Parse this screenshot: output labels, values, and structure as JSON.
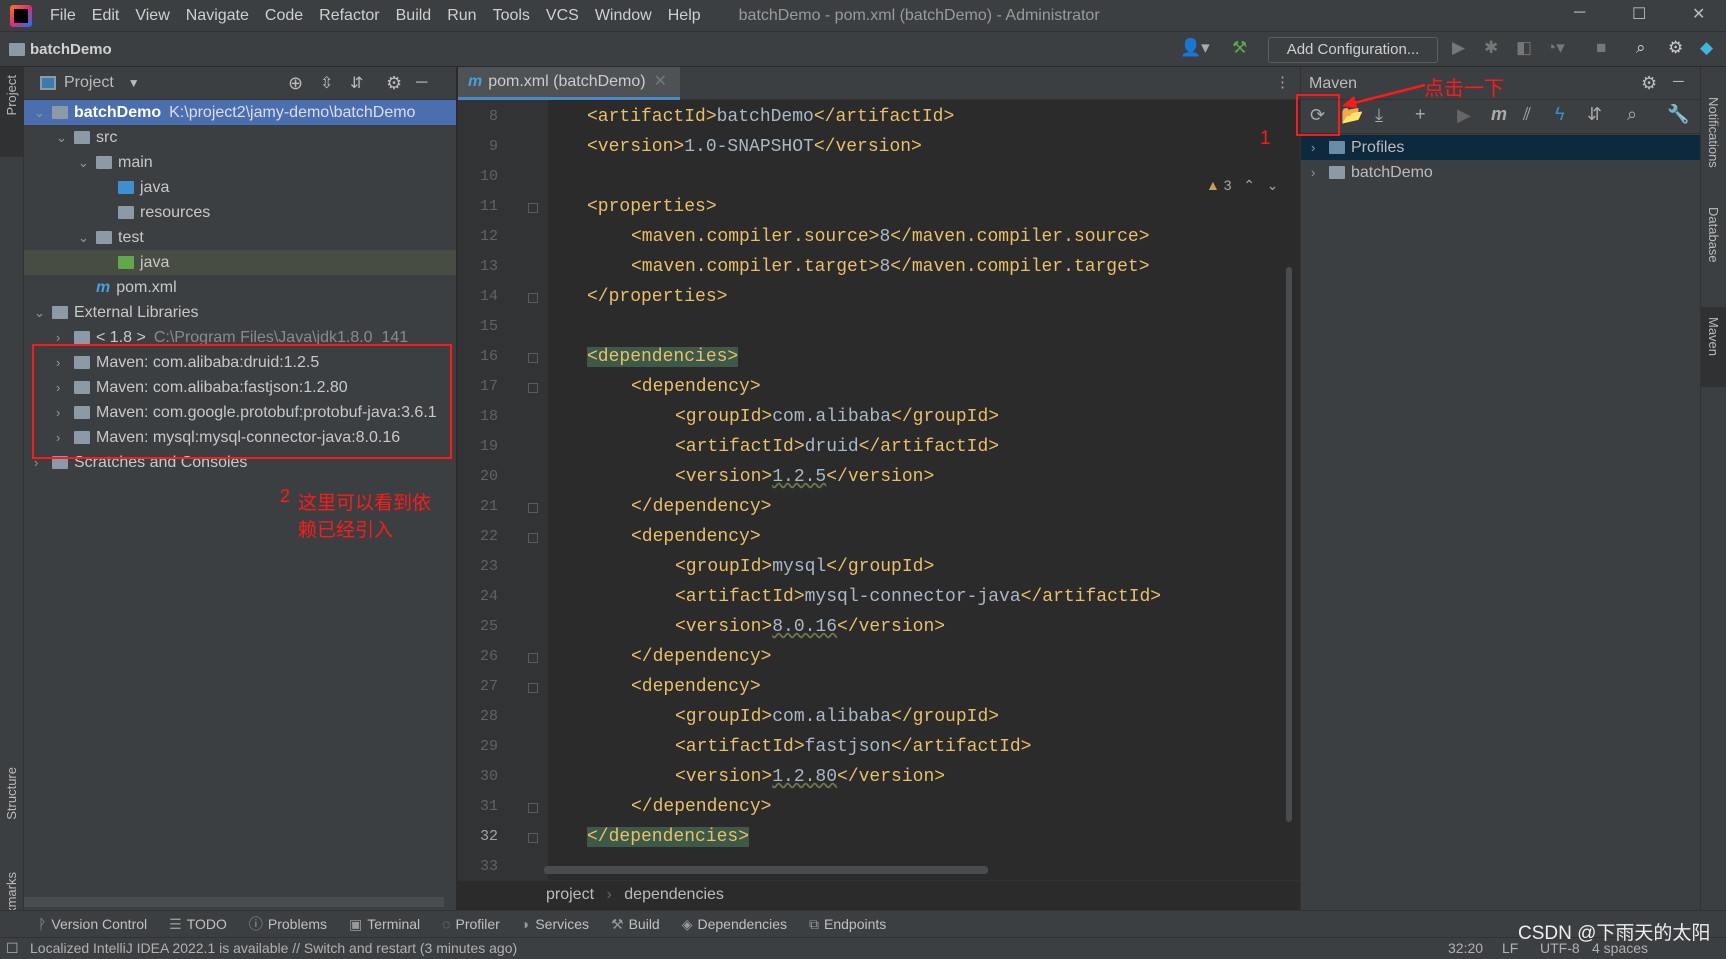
{
  "menubar": {
    "items": [
      "File",
      "Edit",
      "View",
      "Navigate",
      "Code",
      "Refactor",
      "Build",
      "Run",
      "Tools",
      "VCS",
      "Window",
      "Help"
    ],
    "title": "batchDemo - pom.xml (batchDemo) - Administrator"
  },
  "navbar": {
    "project": "batchDemo",
    "add_configuration": "Add Configuration..."
  },
  "left_strip": {
    "project": "Project",
    "structure": "Structure",
    "bookmarks": "Bookmarks"
  },
  "project_panel": {
    "title": "Project",
    "rows": [
      {
        "label": "batchDemo",
        "extra": "K:\\project2\\jamy-demo\\batchDemo",
        "indent": 0,
        "chev": "v",
        "icon": "module-folder-icon",
        "state": "sel",
        "bold": true
      },
      {
        "label": "src",
        "indent": 1,
        "chev": "v",
        "icon": "folder-icon"
      },
      {
        "label": "main",
        "indent": 2,
        "chev": "v",
        "icon": "folder-icon"
      },
      {
        "label": "java",
        "indent": 3,
        "chev": "",
        "icon": "source-folder-icon"
      },
      {
        "label": "resources",
        "indent": 3,
        "chev": "",
        "icon": "resources-folder-icon"
      },
      {
        "label": "test",
        "indent": 2,
        "chev": "v",
        "icon": "folder-icon"
      },
      {
        "label": "java",
        "indent": 3,
        "chev": "",
        "icon": "test-folder-icon",
        "state": "hl"
      },
      {
        "label": "pom.xml",
        "indent": 2,
        "chev": "",
        "icon": "maven-file-icon"
      },
      {
        "label": "External Libraries",
        "indent": 0,
        "chev": "v",
        "icon": "libraries-icon"
      },
      {
        "label": "< 1.8 >",
        "extra": "C:\\Program Files\\Java\\jdk1.8.0_141",
        "indent": 1,
        "chev": ">",
        "icon": "jdk-icon"
      },
      {
        "label": "Maven: com.alibaba:druid:1.2.5",
        "indent": 1,
        "chev": ">",
        "icon": "library-icon"
      },
      {
        "label": "Maven: com.alibaba:fastjson:1.2.80",
        "indent": 1,
        "chev": ">",
        "icon": "library-icon"
      },
      {
        "label": "Maven: com.google.protobuf:protobuf-java:3.6.1",
        "indent": 1,
        "chev": ">",
        "icon": "library-icon"
      },
      {
        "label": "Maven: mysql:mysql-connector-java:8.0.16",
        "indent": 1,
        "chev": ">",
        "icon": "library-icon"
      },
      {
        "label": "Scratches and Consoles",
        "indent": 0,
        "chev": ">",
        "icon": "scratches-icon"
      }
    ]
  },
  "editor": {
    "tab": "pom.xml (batchDemo)",
    "warnings": "3",
    "lines": [
      {
        "n": "8",
        "indent": 1,
        "text": "<artifactId>batchDemo</artifactId>"
      },
      {
        "n": "9",
        "indent": 1,
        "text": "<version>1.0-SNAPSHOT</version>"
      },
      {
        "n": "10",
        "indent": 0,
        "text": ""
      },
      {
        "n": "11",
        "indent": 1,
        "text": "<properties>"
      },
      {
        "n": "12",
        "indent": 2,
        "text": "<maven.compiler.source>8</maven.compiler.source>"
      },
      {
        "n": "13",
        "indent": 2,
        "text": "<maven.compiler.target>8</maven.compiler.target>"
      },
      {
        "n": "14",
        "indent": 1,
        "text": "</properties>"
      },
      {
        "n": "15",
        "indent": 0,
        "text": ""
      },
      {
        "n": "16",
        "indent": 1,
        "text": "<dependencies>",
        "hl": true
      },
      {
        "n": "17",
        "indent": 2,
        "text": "<dependency>"
      },
      {
        "n": "18",
        "indent": 3,
        "text": "<groupId>com.alibaba</groupId>"
      },
      {
        "n": "19",
        "indent": 3,
        "text": "<artifactId>druid</artifactId>"
      },
      {
        "n": "20",
        "indent": 3,
        "text": "<version>1.2.5</version>",
        "ver": true
      },
      {
        "n": "21",
        "indent": 2,
        "text": "</dependency>"
      },
      {
        "n": "22",
        "indent": 2,
        "text": "<dependency>"
      },
      {
        "n": "23",
        "indent": 3,
        "text": "<groupId>mysql</groupId>"
      },
      {
        "n": "24",
        "indent": 3,
        "text": "<artifactId>mysql-connector-java</artifactId>"
      },
      {
        "n": "25",
        "indent": 3,
        "text": "<version>8.0.16</version>",
        "ver": true
      },
      {
        "n": "26",
        "indent": 2,
        "text": "</dependency>"
      },
      {
        "n": "27",
        "indent": 2,
        "text": "<dependency>"
      },
      {
        "n": "28",
        "indent": 3,
        "text": "<groupId>com.alibaba</groupId>"
      },
      {
        "n": "29",
        "indent": 3,
        "text": "<artifactId>fastjson</artifactId>"
      },
      {
        "n": "30",
        "indent": 3,
        "text": "<version>1.2.80</version>",
        "ver": true
      },
      {
        "n": "31",
        "indent": 2,
        "text": "</dependency>"
      },
      {
        "n": "32",
        "indent": 1,
        "text": "</dependencies>",
        "hl": true,
        "current": true
      },
      {
        "n": "33",
        "indent": 0,
        "text": ""
      }
    ],
    "breadcrumbs": [
      "project",
      "dependencies"
    ]
  },
  "maven": {
    "title": "Maven",
    "tree": [
      "Profiles",
      "batchDemo"
    ]
  },
  "right_strip": {
    "notifications": "Notifications",
    "database": "Database",
    "maven": "Maven"
  },
  "annotations": {
    "step1": "1",
    "click_hint": "点击一下",
    "step2": "2",
    "step2_text_line1": "这里可以看到依",
    "step2_text_line2": "赖已经引入"
  },
  "tool_windows": [
    "Version Control",
    "TODO",
    "Problems",
    "Terminal",
    "Profiler",
    "Services",
    "Build",
    "Dependencies",
    "Endpoints"
  ],
  "status": {
    "message": "Localized IntelliJ IDEA 2022.1 is available // Switch and restart (3 minutes ago)",
    "position": "32:20",
    "line_sep": "LF",
    "encoding": "UTF-8",
    "indent": "4 spaces",
    "watermark": "CSDN @下雨天的太阳"
  }
}
